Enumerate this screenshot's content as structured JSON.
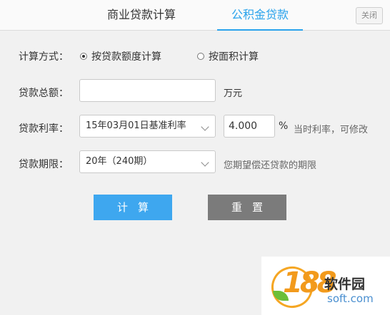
{
  "tabs": {
    "commercial_label": "商业贷款计算",
    "fund_label": "公积金贷款",
    "active": "fund",
    "accent": "#2aa3ec"
  },
  "window": {
    "close_label": "关闭"
  },
  "form": {
    "method": {
      "label": "计算方式：",
      "options": [
        {
          "label": "按贷款额度计算",
          "checked": true
        },
        {
          "label": "按面积计算",
          "checked": false
        }
      ]
    },
    "amount": {
      "label": "贷款总额：",
      "value": "",
      "unit": "万元"
    },
    "rate": {
      "label": "贷款利率：",
      "selected": "15年03月01日基准利率",
      "value": "4.000",
      "unit": "%",
      "hint": "当时利率，可修改"
    },
    "term": {
      "label": "贷款期限：",
      "selected": "20年（240期）",
      "hint": "您期望偿还贷款的期限"
    }
  },
  "buttons": {
    "calculate": "计算",
    "reset": "重置",
    "calculate_color": "#3ea7ef",
    "reset_color": "#7b7b7b"
  },
  "watermark": {
    "number": "188",
    "name": "软件园",
    "site": "soft.com"
  }
}
